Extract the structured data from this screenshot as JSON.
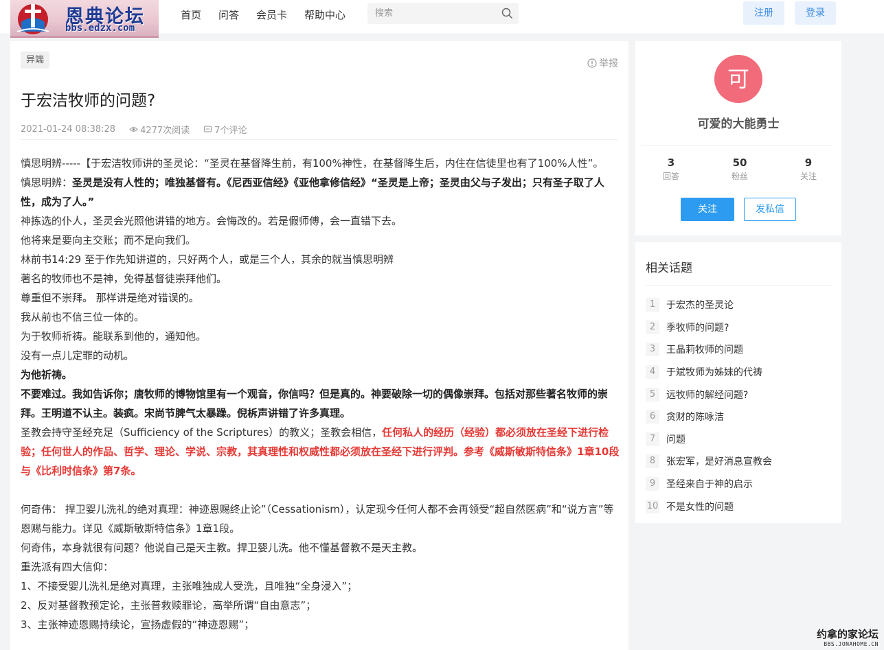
{
  "header": {
    "logo_title": "恩典论坛",
    "logo_url": "bbs.edzx.com",
    "nav": [
      "首页",
      "问答",
      "会员卡",
      "帮助中心"
    ],
    "search_placeholder": "搜索",
    "register": "注册",
    "login": "登录"
  },
  "post": {
    "tag": "异端",
    "report": "举报",
    "title": "于宏洁牧师的问题?",
    "date": "2021-01-24 08:38:28",
    "views": "4277次阅读",
    "comments": "7个评论",
    "paragraphs": [
      [
        {
          "t": "  慎思明辨-----【于宏洁牧师讲的圣灵论：“圣灵在基督降生前，有100%神性，在基督降生后，内住在信徒里也有了100%人性”。",
          "s": ""
        }
      ],
      [
        {
          "t": "  慎思明辨：",
          "s": ""
        },
        {
          "t": "圣灵是没有人性的；唯独基督有。《尼西亚信经》《亚他拿修信经》“圣灵是上帝；圣灵由父与子发出；只有圣子取了人性，成为了人。”",
          "s": "b"
        }
      ],
      [
        {
          "t": "神拣选的仆人，圣灵会光照他讲错的地方。会悔改的。若是假师傅，会一直错下去。",
          "s": ""
        }
      ],
      [
        {
          "t": "他将来是要向主交账；而不是向我们。",
          "s": ""
        }
      ],
      [
        {
          "t": "林前书14:29 至于作先知讲道的，只好两个人，或是三个人，其余的就当慎思明辨",
          "s": ""
        }
      ],
      [
        {
          "t": "著名的牧师也不是神，免得基督徒崇拜他们。",
          "s": ""
        }
      ],
      [
        {
          "t": "尊重但不崇拜。 那样讲是绝对错误的。",
          "s": ""
        }
      ],
      [
        {
          "t": "我从前也不信三位一体的。",
          "s": ""
        }
      ],
      [
        {
          "t": "为于牧师祈祷。能联系到他的，通知他。",
          "s": ""
        }
      ],
      [
        {
          "t": "没有一点儿定罪的动机。",
          "s": ""
        }
      ],
      [
        {
          "t": "为他祈祷。",
          "s": "b"
        }
      ],
      [
        {
          "t": "   不要难过。我如告诉你；唐牧师的博物馆里有一个观音，你信吗？但是真的。神要破除一切的偶像崇拜。包括对那些著名牧师的崇拜。王明道不认主。装疯。宋尚节脾气太暴躁。倪柝声讲错了许多真理。",
          "s": "b"
        }
      ],
      [
        {
          "t": "   圣教会持守圣经充足（Sufficiency of the Scriptures）的教义；圣教会相信，",
          "s": ""
        },
        {
          "t": "任何私人的经历（经验）都必须放在圣经下进行检验；任何世人的作品、哲学、理论、学说、宗教，其真理性和权威性都必须放在圣经下进行评判。参考《威斯敏斯特信条》1章10段与《比利时信条》第7条。",
          "s": "r"
        }
      ],
      [],
      [
        {
          "t": "  何奇伟： 捍卫婴儿洗礼的绝对真理：神迹恩赐终止论”（Cessationism），认定现今任何人都不会再领受“超自然医病”和“说方言”等恩赐与能力。详见《威斯敏斯特信条》1章1段。",
          "s": ""
        }
      ],
      [
        {
          "t": "何奇伟，本身就很有问题？他说自己是天主教。捍卫婴儿洗。他不懂基督教不是天主教。",
          "s": ""
        }
      ],
      [
        {
          "t": "  重洗派有四大信仰：",
          "s": ""
        }
      ],
      [
        {
          "t": "1、不接受婴儿洗礼是绝对真理，主张唯独成人受洗，且唯独“全身浸入”；",
          "s": ""
        }
      ],
      [
        {
          "t": "2、反对基督教预定论，主张普救赎罪论，高举所谓“自由意志”；",
          "s": ""
        }
      ],
      [
        {
          "t": "3、主张神迹恩赐持续论，宣扬虚假的“神迹恩赐”；",
          "s": ""
        }
      ]
    ]
  },
  "profile": {
    "avatar_char": "可",
    "name": "可爱的大能勇士",
    "stats": [
      {
        "num": "3",
        "label": "回答"
      },
      {
        "num": "50",
        "label": "粉丝"
      },
      {
        "num": "9",
        "label": "关注"
      }
    ],
    "follow": "关注",
    "message": "发私信"
  },
  "related": {
    "title": "相关话题",
    "items": [
      {
        "num": "1",
        "text": "于宏杰的圣灵论"
      },
      {
        "num": "2",
        "text": "季牧师的问题?"
      },
      {
        "num": "3",
        "text": "王晶莉牧师的问题"
      },
      {
        "num": "4",
        "text": "于斌牧师为姊妹的代祷"
      },
      {
        "num": "5",
        "text": "远牧师的解经问题?"
      },
      {
        "num": "6",
        "text": "贪财的陈咏洁"
      },
      {
        "num": "7",
        "text": "问题"
      },
      {
        "num": "8",
        "text": "张宏军，是好消息宣教会"
      },
      {
        "num": "9",
        "text": "圣经来自于神的启示"
      },
      {
        "num": "10",
        "text": "不是女性的问题"
      }
    ]
  },
  "watermark": {
    "line1": "约拿的家论坛",
    "line2": "BBS.JONAHOME.CN"
  },
  "colors": {
    "accent": "#2d9cf0",
    "red_text": "#e53935",
    "avatar_bg": "#f26b7a"
  }
}
